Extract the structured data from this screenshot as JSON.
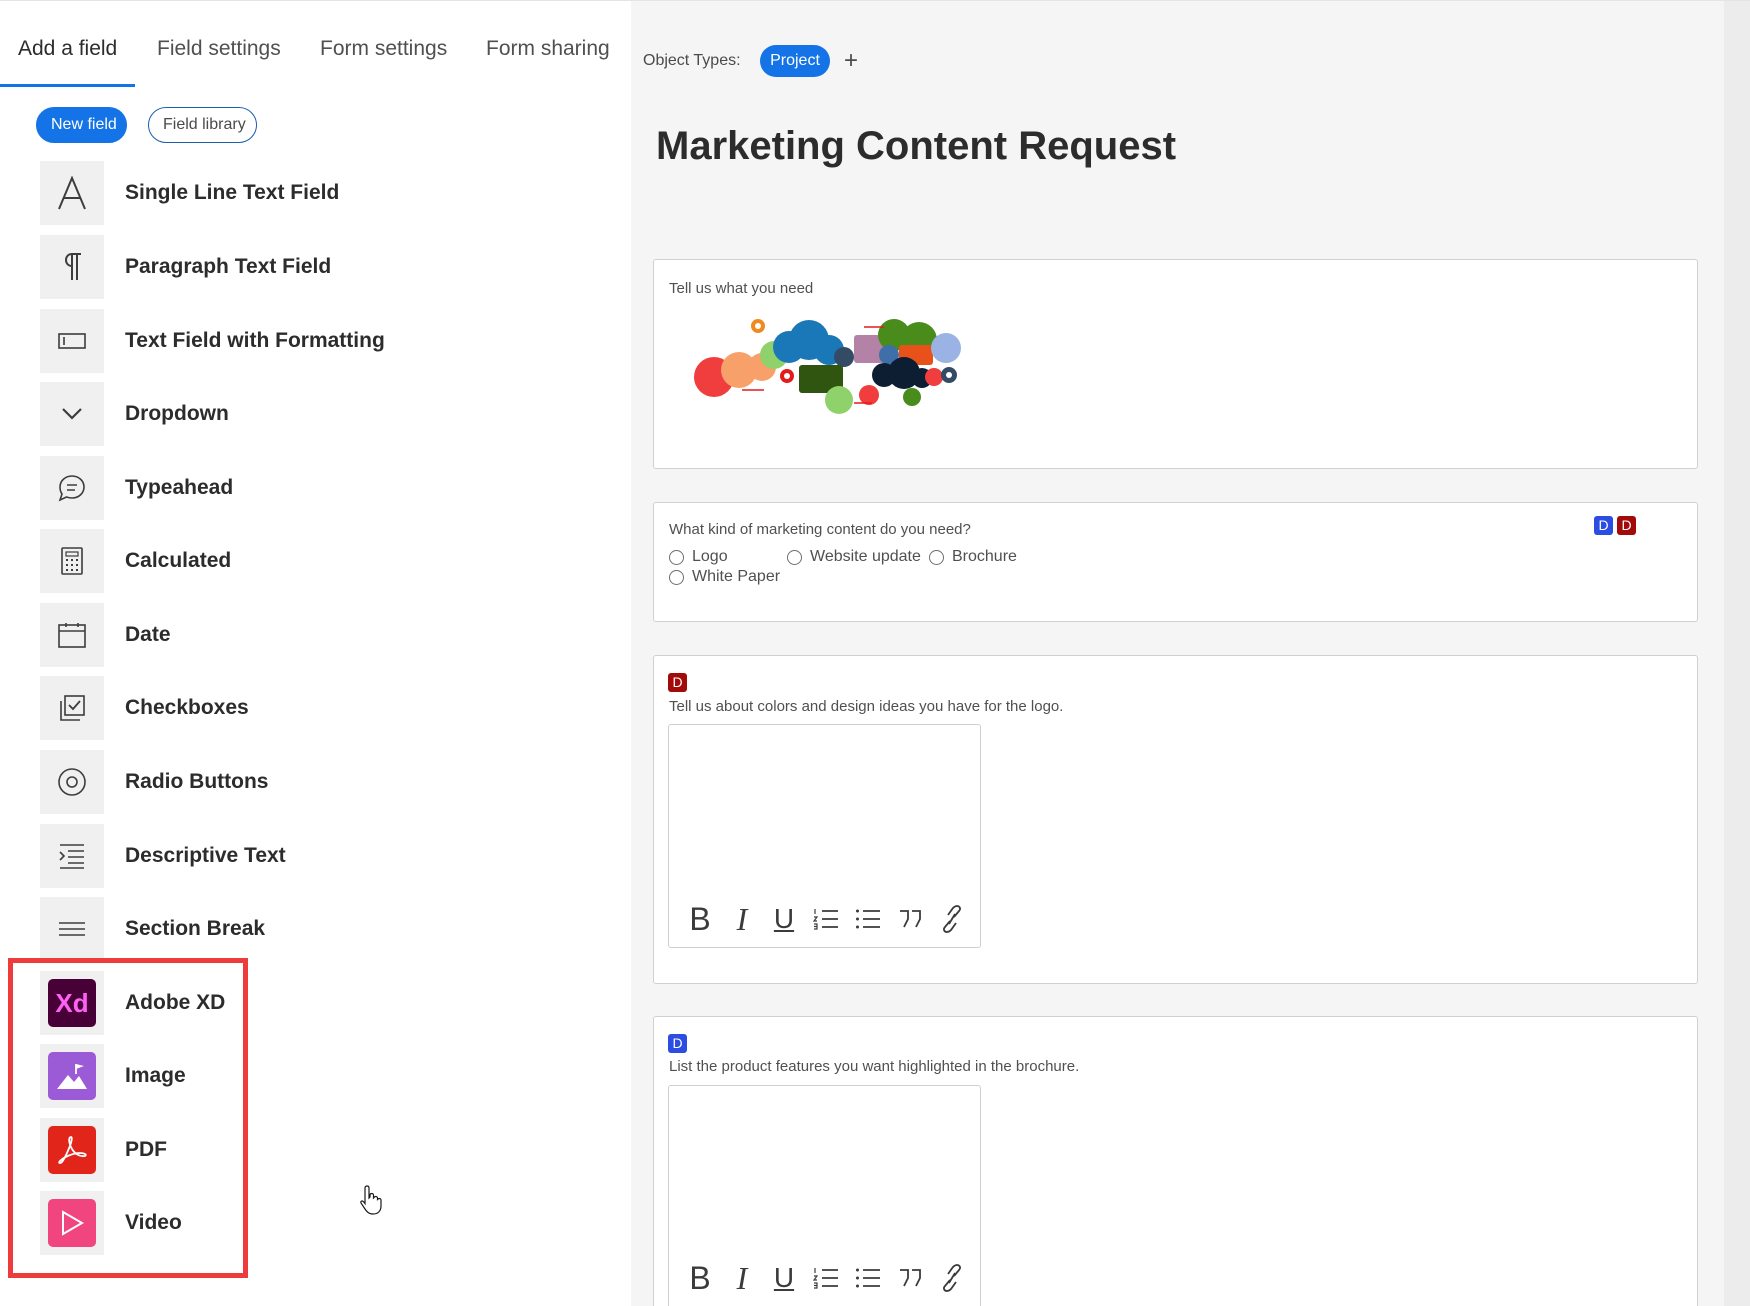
{
  "tabs": [
    {
      "label": "Add a field"
    },
    {
      "label": "Field settings"
    },
    {
      "label": "Form settings"
    },
    {
      "label": "Form sharing"
    }
  ],
  "toggle": {
    "new_field": "New field",
    "field_library": "Field library"
  },
  "fields": [
    {
      "label": "Single Line Text Field",
      "icon": "letter-a-icon"
    },
    {
      "label": "Paragraph Text Field",
      "icon": "paragraph-icon"
    },
    {
      "label": "Text Field with Formatting",
      "icon": "text-box-icon"
    },
    {
      "label": "Dropdown",
      "icon": "chevron-down-icon"
    },
    {
      "label": "Typeahead",
      "icon": "speech-bubble-icon"
    },
    {
      "label": "Calculated",
      "icon": "calculator-icon"
    },
    {
      "label": "Date",
      "icon": "calendar-icon"
    },
    {
      "label": "Checkboxes",
      "icon": "checkbox-icon"
    },
    {
      "label": "Radio Buttons",
      "icon": "radio-icon"
    },
    {
      "label": "Descriptive Text",
      "icon": "descriptive-text-icon"
    },
    {
      "label": "Section Break",
      "icon": "section-break-icon"
    },
    {
      "label": "Adobe XD",
      "icon": "adobe-xd-icon",
      "tile_text": "Xd"
    },
    {
      "label": "Image",
      "icon": "image-icon"
    },
    {
      "label": "PDF",
      "icon": "pdf-icon"
    },
    {
      "label": "Video",
      "icon": "video-icon"
    }
  ],
  "form": {
    "object_types_label": "Object Types:",
    "object_type": "Project",
    "add_symbol": "+",
    "title": "Marketing Content Request",
    "sections": [
      {
        "label": "Tell us what you need",
        "image": "marketing-clouds-illustration"
      },
      {
        "label": "What kind of marketing content do you need?",
        "badges": [
          "D",
          "D"
        ],
        "options": [
          "Logo",
          "Website update",
          "Brochure",
          "White Paper"
        ]
      },
      {
        "badge": "D",
        "label": "Tell us about colors and design ideas you have for the logo."
      },
      {
        "badge": "D",
        "label": "List the product features you want highlighted in the brochure."
      }
    ],
    "toolbar": {
      "bold": "B",
      "italic": "I",
      "underline": "U"
    }
  },
  "colors": {
    "accent": "#1473e6",
    "highlight": "#ee3b3b",
    "xd_bg": "#470137",
    "xd_fg": "#ff61f6",
    "image_tile": "#9b5ad6",
    "pdf_tile": "#e1251b",
    "video_tile": "#f0457f",
    "badge_blue": "#2b4de1",
    "badge_red": "#a30b0b"
  }
}
